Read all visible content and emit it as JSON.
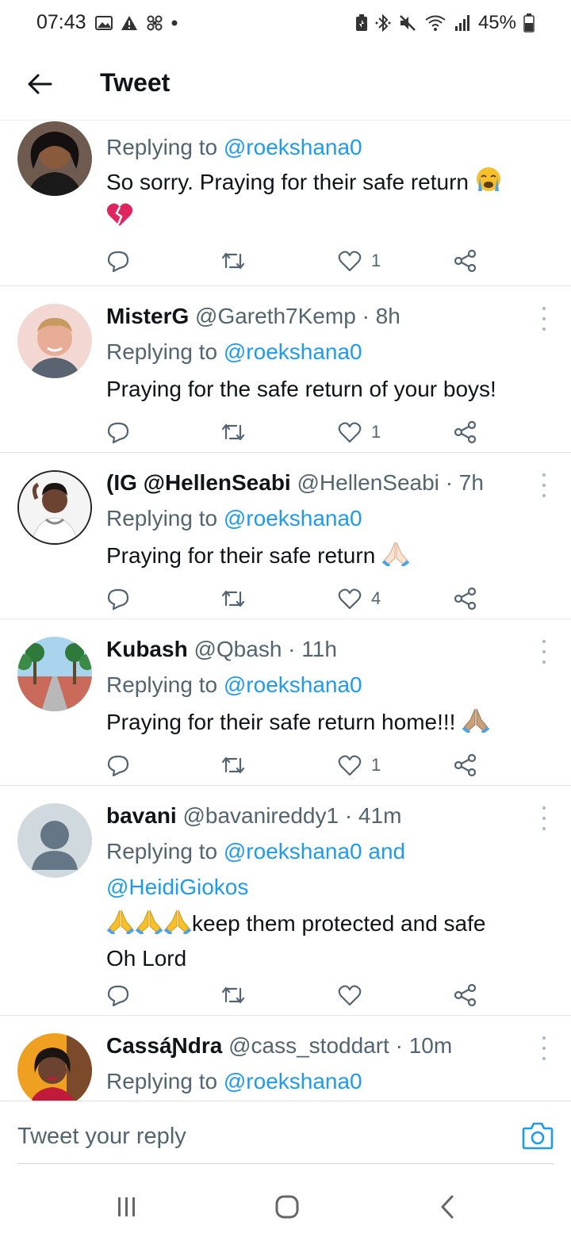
{
  "status_bar": {
    "time": "07:43",
    "battery": "45%",
    "left_icons": [
      "gallery-icon",
      "alert-icon",
      "fan-icon",
      "dot-icon"
    ],
    "right_icons": [
      "battery-saver-icon",
      "bluetooth-icon",
      "mute-icon",
      "wifi-icon",
      "signal-icon"
    ]
  },
  "header": {
    "back_icon": "arrow-left-icon",
    "title": "Tweet"
  },
  "accent_color": "#1d9bf0",
  "tweets": [
    {
      "reply_prefix": "Replying to ",
      "reply_to": "@roekshana0",
      "text": "So sorry. Praying for their safe return",
      "text_emojis": [
        "loudly-crying-face",
        "broken-heart"
      ],
      "replies": "",
      "retweets": "",
      "likes": "1"
    },
    {
      "name": "MisterG",
      "handle": "@Gareth7Kemp",
      "time": "8h",
      "reply_prefix": "Replying to ",
      "reply_to": "@roekshana0",
      "text": "Praying for the safe return of your boys!",
      "likes": "1"
    },
    {
      "name": "(IG @HellenSeabi",
      "handle": "@HellenSeabi",
      "time": "7h",
      "reply_prefix": "Replying to ",
      "reply_to": "@roekshana0",
      "text": "Praying for their safe return",
      "text_emojis": [
        "folded-hands"
      ],
      "likes": "4"
    },
    {
      "name": "Kubash",
      "handle": "@Qbash",
      "time": "11h",
      "reply_prefix": "Replying to ",
      "reply_to": "@roekshana0",
      "text": "Praying for their safe return home!!!",
      "text_emojis": [
        "folded-hands"
      ],
      "likes": "1"
    },
    {
      "name": "bavani",
      "handle": "@bavanireddy1",
      "time": "41m",
      "reply_prefix": "Replying to ",
      "reply_to": "@roekshana0 and",
      "reply_to_2": "@HeidiGiokos",
      "text": "keep them protected and safe",
      "text_2": "Oh Lord",
      "text_emojis": [
        "folded-hands",
        "folded-hands",
        "folded-hands"
      ],
      "likes": ""
    },
    {
      "name": "CassáƝdra",
      "handle": "@cass_stoddart",
      "time": "10m",
      "reply_prefix": "Replying to ",
      "reply_to": "@roekshana0"
    }
  ],
  "reply_bar": {
    "placeholder": "Tweet your reply",
    "camera_icon": "camera-icon"
  },
  "nav_bar": {
    "icons": [
      "recent-apps-icon",
      "home-icon",
      "back-icon"
    ]
  }
}
